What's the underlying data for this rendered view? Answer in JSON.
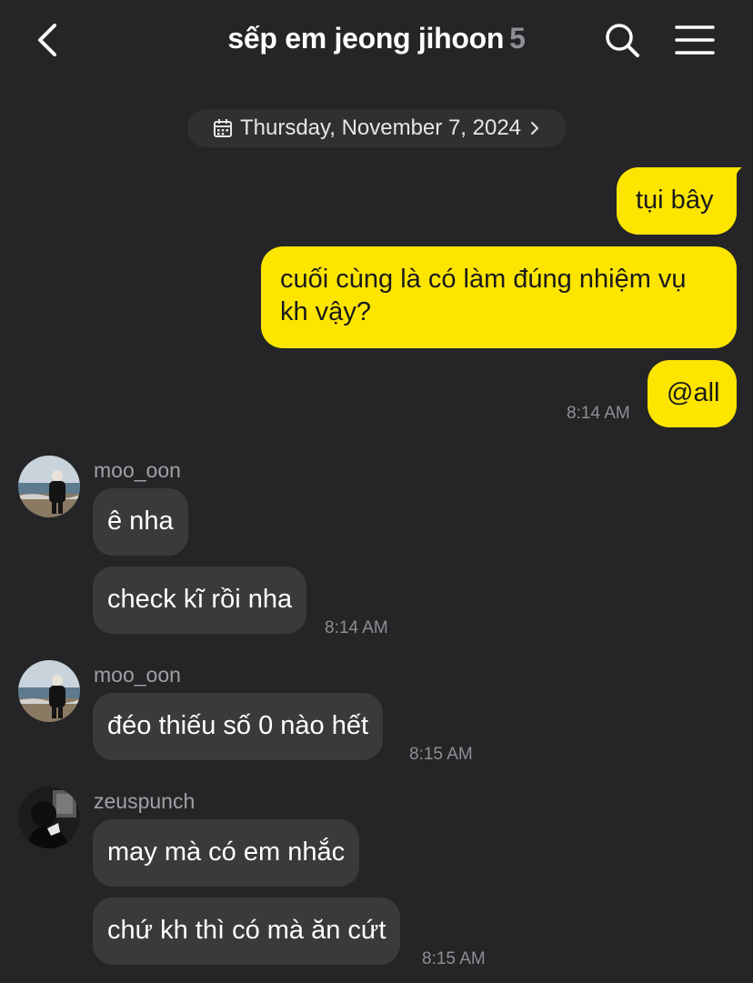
{
  "header": {
    "title": "sếp em jeong jihoon",
    "member_count": "5",
    "back_icon": "chevron-left-icon",
    "search_icon": "search-icon",
    "menu_icon": "hamburger-menu-icon"
  },
  "date_divider": {
    "label": "Thursday, November 7, 2024",
    "icon": "calendar-icon"
  },
  "colors": {
    "background": "#252527",
    "outgoing_bubble": "#fee500",
    "incoming_bubble": "#3a3a3c"
  },
  "outgoing": [
    {
      "text": "tụi bây"
    },
    {
      "text_line1": "cuối cùng là có làm đúng nhiệm vụ",
      "text_line2": "kh vậy?"
    },
    {
      "text": "@all",
      "time": "8:14 AM"
    }
  ],
  "groups": [
    {
      "sender": "moo_oon",
      "messages": [
        {
          "text": "ê nha"
        },
        {
          "text": "check kĩ rồi nha",
          "time": "8:14 AM"
        }
      ]
    },
    {
      "sender": "moo_oon",
      "messages": [
        {
          "text": "đéo thiếu số 0 nào hết",
          "time": "8:15 AM"
        }
      ]
    },
    {
      "sender": "zeuspunch",
      "messages": [
        {
          "text": "may mà có em nhắc"
        },
        {
          "text": "chứ kh thì có mà ăn cứt",
          "time": "8:15 AM"
        }
      ]
    }
  ]
}
